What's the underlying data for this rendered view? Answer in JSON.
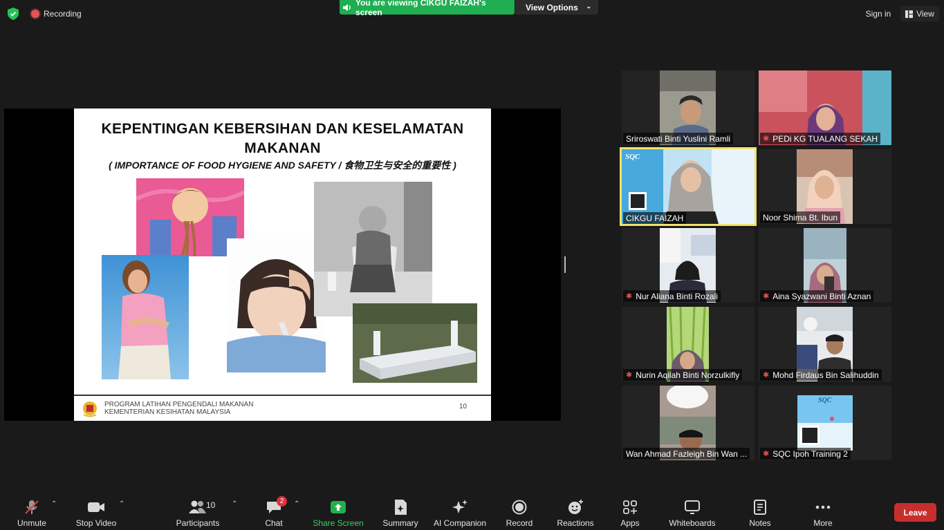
{
  "topbar": {
    "recording_label": "Recording",
    "viewing_banner": "You are viewing CIKGU FAIZAH's screen",
    "view_options_label": "View Options",
    "sign_in_label": "Sign in",
    "view_label": "View",
    "banner_color": "#1fae51"
  },
  "slide": {
    "title_line1": "KEPENTINGAN KEBERSIHAN DAN KESELAMATAN",
    "title_line2": "MAKANAN",
    "subtitle": "( IMPORTANCE OF FOOD HYGIENE AND SAFETY / 食物卫生与安全的重要性 )",
    "footer_line1": "PROGRAM LATIHAN PENGENDALI MAKANAN",
    "footer_line2": "KEMENTERIAN KESIHATAN MALAYSIA",
    "page_number": "10"
  },
  "participants": [
    {
      "name": "Sriroswati Binti Yuslini Ramli",
      "muted": false
    },
    {
      "name": "PEDi KG TUALANG SEKAH",
      "muted": true
    },
    {
      "name": "CIKGU FAIZAH",
      "muted": false,
      "active_speaker": true
    },
    {
      "name": "Noor Shima Bt. Ibun",
      "muted": false
    },
    {
      "name": "Nur Aliana Binti Rozali",
      "muted": true
    },
    {
      "name": "Aina Syazwani Binti Aznan",
      "muted": true
    },
    {
      "name": "Nurin Aqilah Binti Norzulkifly",
      "muted": true
    },
    {
      "name": "Mohd Firdaus Bin Salihuddin",
      "muted": true
    },
    {
      "name": "Wan Ahmad Fazleigh Bin Wan ...",
      "muted": false
    },
    {
      "name": "SQC Ipoh Training 2",
      "muted": true
    }
  ],
  "toolbar": {
    "unmute": "Unmute",
    "stop_video": "Stop Video",
    "participants": "Participants",
    "participants_count": "10",
    "chat": "Chat",
    "chat_badge": "2",
    "share_screen": "Share Screen",
    "summary": "Summary",
    "ai_companion": "AI Companion",
    "record": "Record",
    "reactions": "Reactions",
    "apps": "Apps",
    "whiteboards": "Whiteboards",
    "notes": "Notes",
    "more": "More",
    "leave": "Leave",
    "leave_color": "#c72e2e"
  }
}
